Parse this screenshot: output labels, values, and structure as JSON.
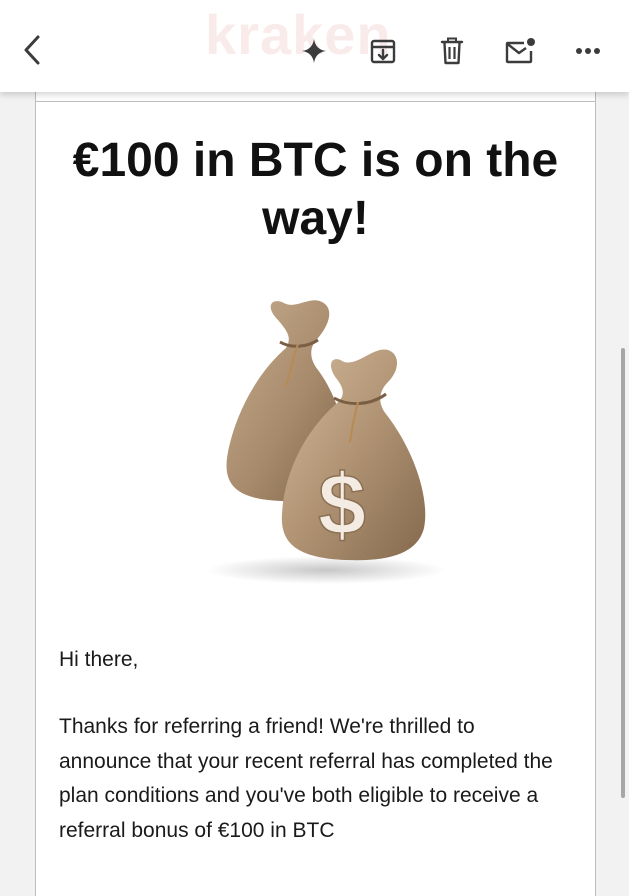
{
  "toolbar": {
    "brand_watermark": "kraken",
    "icons": {
      "back": "back-chevron-icon",
      "sparkle": "sparkle-icon",
      "archive": "archive-icon",
      "delete": "trash-icon",
      "unread": "mark-unread-icon",
      "more": "more-horizontal-icon"
    }
  },
  "email": {
    "headline": "€100 in BTC is on the way!",
    "illustration": "money-bags-illustration",
    "greeting": "Hi there,",
    "body": "Thanks for referring a friend! We're thrilled to announce that your recent referral has completed the plan conditions and you've both eligible to receive a referral bonus of €100 in BTC"
  },
  "colors": {
    "text": "#111111",
    "toolbar_icon": "#3c3c3c",
    "background": "#f2f2f2",
    "card": "#ffffff",
    "bag": "#a88a6c"
  }
}
